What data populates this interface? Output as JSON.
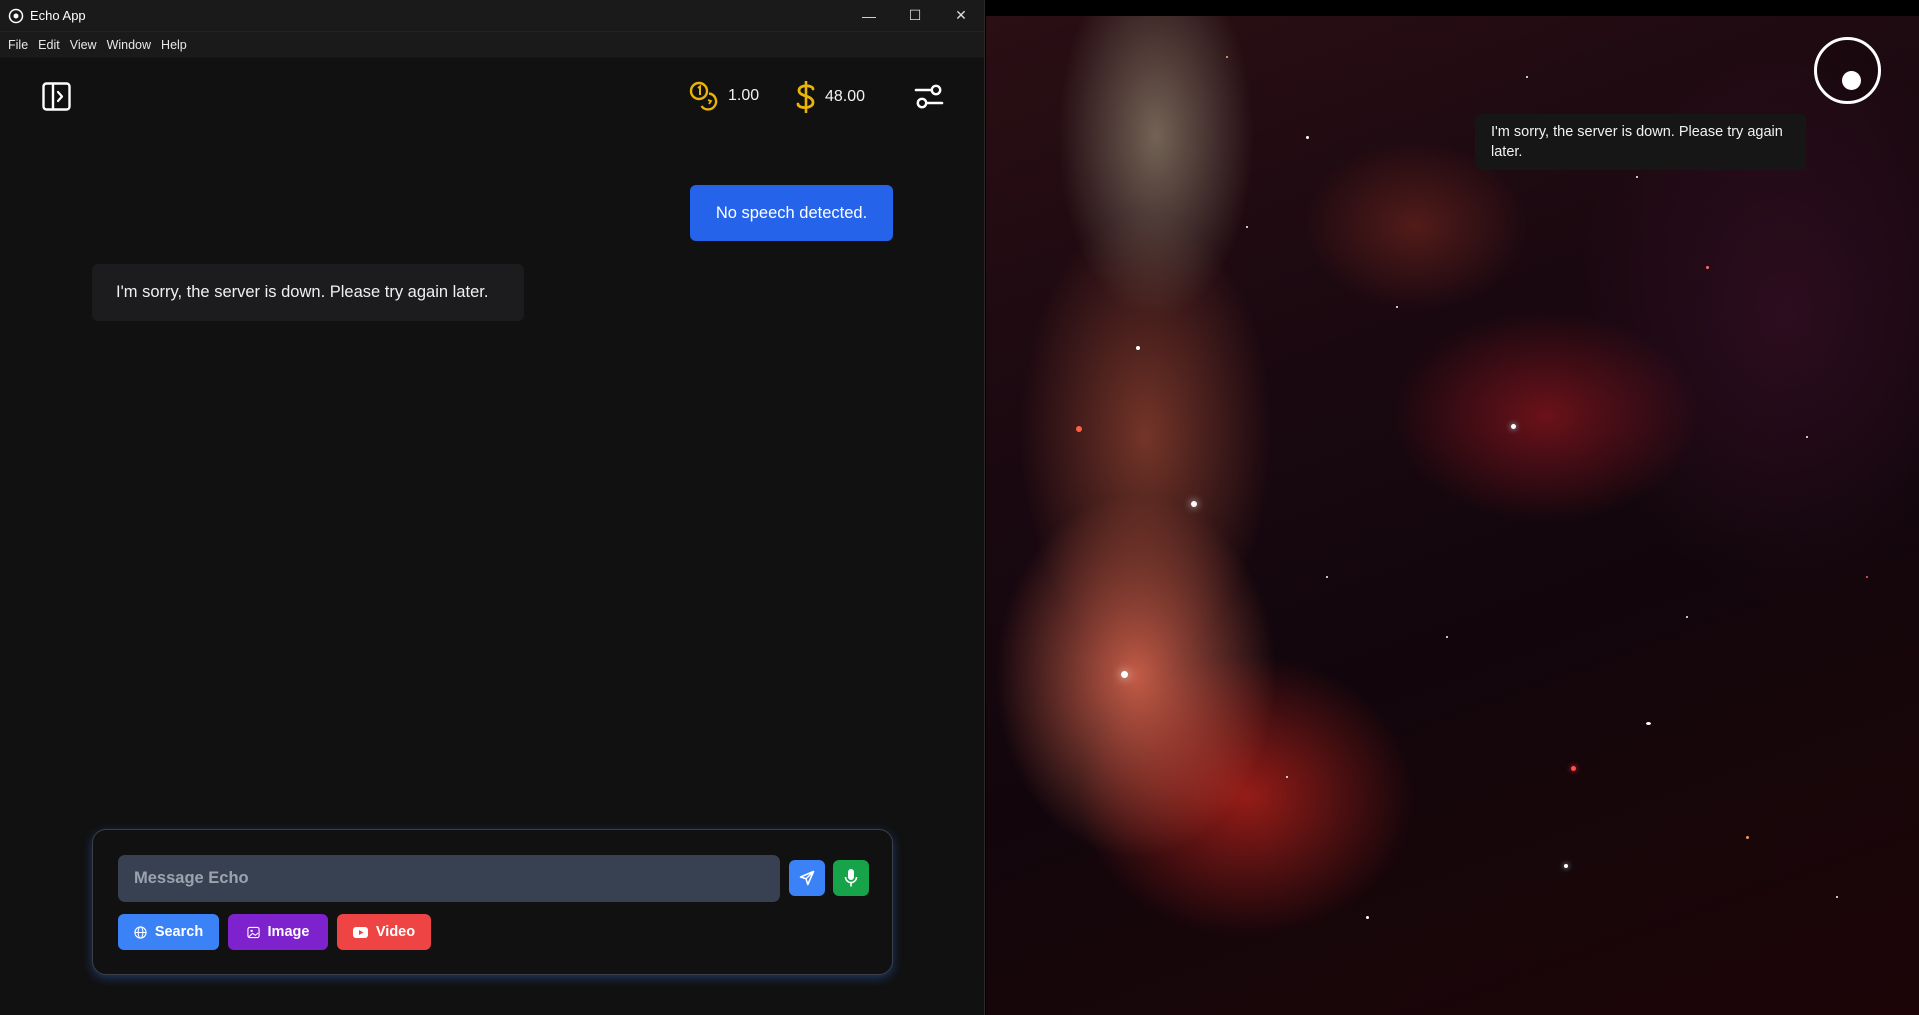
{
  "window": {
    "title": "Echo App",
    "controls": {
      "minimize": "—",
      "maximize": "☐",
      "close": "✕"
    }
  },
  "menu": [
    "File",
    "Edit",
    "View",
    "Window",
    "Help"
  ],
  "stats": {
    "coins_value": "1.00",
    "dollars_value": "48.00"
  },
  "chat": {
    "user_message": "No speech detected.",
    "bot_message": "I'm sorry, the server is down. Please try again later."
  },
  "composer": {
    "placeholder": "Message Echo",
    "search_label": "Search",
    "image_label": "Image",
    "video_label": "Video"
  },
  "overlay": {
    "toast_message": "I'm sorry, the server is down. Please try again later."
  },
  "colors": {
    "accent_blue": "#2563eb",
    "send_blue": "#3b82f6",
    "mic_green": "#16a34a",
    "image_purple": "#7e22ce",
    "video_red": "#ef4444",
    "coin_yellow": "#eab308"
  }
}
